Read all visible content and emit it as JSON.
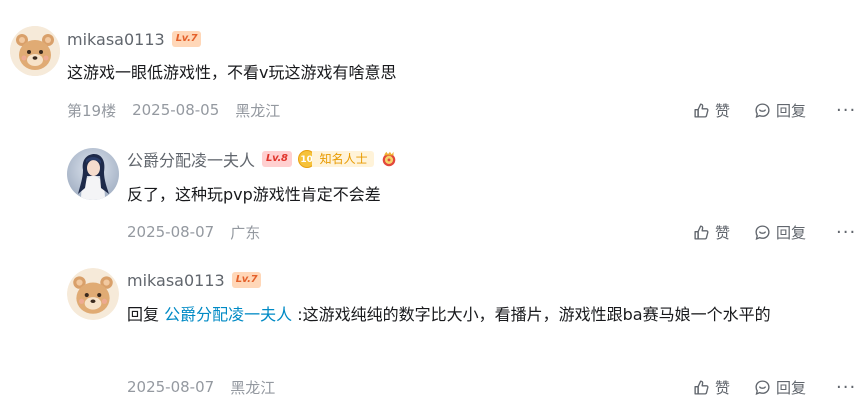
{
  "comments": [
    {
      "username": "mikasa0113",
      "level": "Lv.7",
      "content": "这游戏一眼低游戏性，不看v玩这游戏有啥意思",
      "floor": "第19楼",
      "date": "2025-08-05",
      "location": "黑龙江",
      "like_label": "赞",
      "reply_label": "回复",
      "more": "···"
    }
  ],
  "replies": [
    {
      "username": "公爵分配凌一夫人",
      "level": "Lv.8",
      "fans_level": "10",
      "fans_title": "知名人士",
      "content": "反了，这种玩pvp游戏性肯定不会差",
      "date": "2025-08-07",
      "location": "广东",
      "like_label": "赞",
      "reply_label": "回复",
      "more": "···"
    },
    {
      "username": "mikasa0113",
      "level": "Lv.7",
      "reply_prefix": "回复",
      "reply_to": "公爵分配凌一夫人",
      "content": ":这游戏纯纯的数字比大小，看播片，游戏性跟ba赛马娘一个水平的",
      "date": "2025-08-07",
      "location": "黑龙江",
      "like_label": "赞",
      "reply_label": "回复",
      "more": "···"
    }
  ],
  "colors": {
    "username": "#61666d",
    "meta": "#9499a0",
    "mention": "#008ac5",
    "lv7": "#e4602a",
    "lv8": "#e0352c"
  }
}
